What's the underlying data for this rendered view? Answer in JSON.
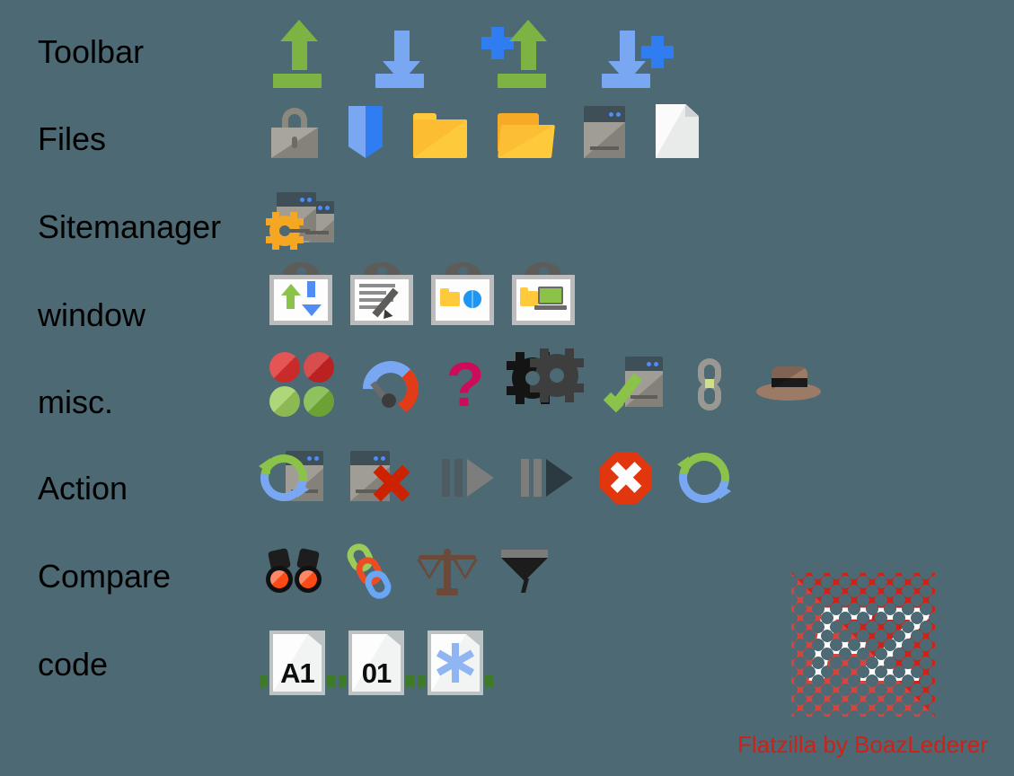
{
  "theme": {
    "background": "#4c6974",
    "label_color": "#000000",
    "accent_red": "#cc2218",
    "green": "#7cb342",
    "blue": "#7aa7f2",
    "bright_blue": "#2f7df0",
    "yellow": "#ffc93c",
    "gray": "#a09d96"
  },
  "rows": [
    {
      "label": "Toolbar",
      "icons": [
        {
          "name": "upload-icon",
          "title": "Upload"
        },
        {
          "name": "download-icon",
          "title": "Download"
        },
        {
          "name": "add-to-queue-upload-icon",
          "title": "Add files to queue (upload)"
        },
        {
          "name": "add-to-queue-download-icon",
          "title": "Add files to queue (download)"
        }
      ]
    },
    {
      "label": "Files",
      "icons": [
        {
          "name": "lock-icon",
          "title": "Locked / permissions"
        },
        {
          "name": "bookmark-icon",
          "title": "Bookmark"
        },
        {
          "name": "folder-closed-icon",
          "title": "Folder"
        },
        {
          "name": "folder-open-icon",
          "title": "Open folder"
        },
        {
          "name": "server-icon",
          "title": "Server"
        },
        {
          "name": "file-icon",
          "title": "File"
        }
      ]
    },
    {
      "label": "Sitemanager",
      "icons": [
        {
          "name": "site-manager-icon",
          "title": "Site Manager"
        }
      ]
    },
    {
      "label": "window",
      "icons": [
        {
          "name": "toggle-transfer-queue-icon",
          "title": "Toggle transfer queue"
        },
        {
          "name": "toggle-message-log-icon",
          "title": "Toggle message log"
        },
        {
          "name": "toggle-remote-tree-icon",
          "title": "Toggle remote directory tree"
        },
        {
          "name": "toggle-local-tree-icon",
          "title": "Toggle local directory tree"
        }
      ]
    },
    {
      "label": "misc.",
      "icons": [
        {
          "name": "four-dots-icon",
          "title": "Process queue toggle"
        },
        {
          "name": "speed-limit-icon",
          "title": "Speed limits"
        },
        {
          "name": "question-mark-icon",
          "title": "Help"
        },
        {
          "name": "gears-icon",
          "title": "Settings"
        },
        {
          "name": "server-check-icon",
          "title": "Server verified"
        },
        {
          "name": "chain-link-icon",
          "title": "Link"
        },
        {
          "name": "hat-icon",
          "title": "Welcome / about"
        }
      ]
    },
    {
      "label": "Action",
      "icons": [
        {
          "name": "reconnect-server-icon",
          "title": "Reconnect"
        },
        {
          "name": "disconnect-server-icon",
          "title": "Disconnect"
        },
        {
          "name": "pause-play-light-icon",
          "title": "Process queue"
        },
        {
          "name": "pause-play-dark-icon",
          "title": "Process queue (active)"
        },
        {
          "name": "cancel-icon",
          "title": "Cancel operation"
        },
        {
          "name": "refresh-icon",
          "title": "Refresh"
        }
      ]
    },
    {
      "label": "Compare",
      "icons": [
        {
          "name": "binoculars-icon",
          "title": "Search remote files"
        },
        {
          "name": "chain-colored-icon",
          "title": "Synchronized browsing"
        },
        {
          "name": "scales-icon",
          "title": "Directory comparison"
        },
        {
          "name": "filter-funnel-icon",
          "title": "Filter"
        }
      ]
    },
    {
      "label": "code",
      "icons": [
        {
          "name": "transfer-type-ascii-icon",
          "title": "ASCII transfer",
          "text": "A1"
        },
        {
          "name": "transfer-type-binary-icon",
          "title": "Binary transfer",
          "text": "01"
        },
        {
          "name": "transfer-type-auto-icon",
          "title": "Auto transfer",
          "text": "*"
        }
      ]
    }
  ],
  "logo": {
    "mark": "FZ",
    "caption": "Flatzilla  by BoazLederer"
  }
}
